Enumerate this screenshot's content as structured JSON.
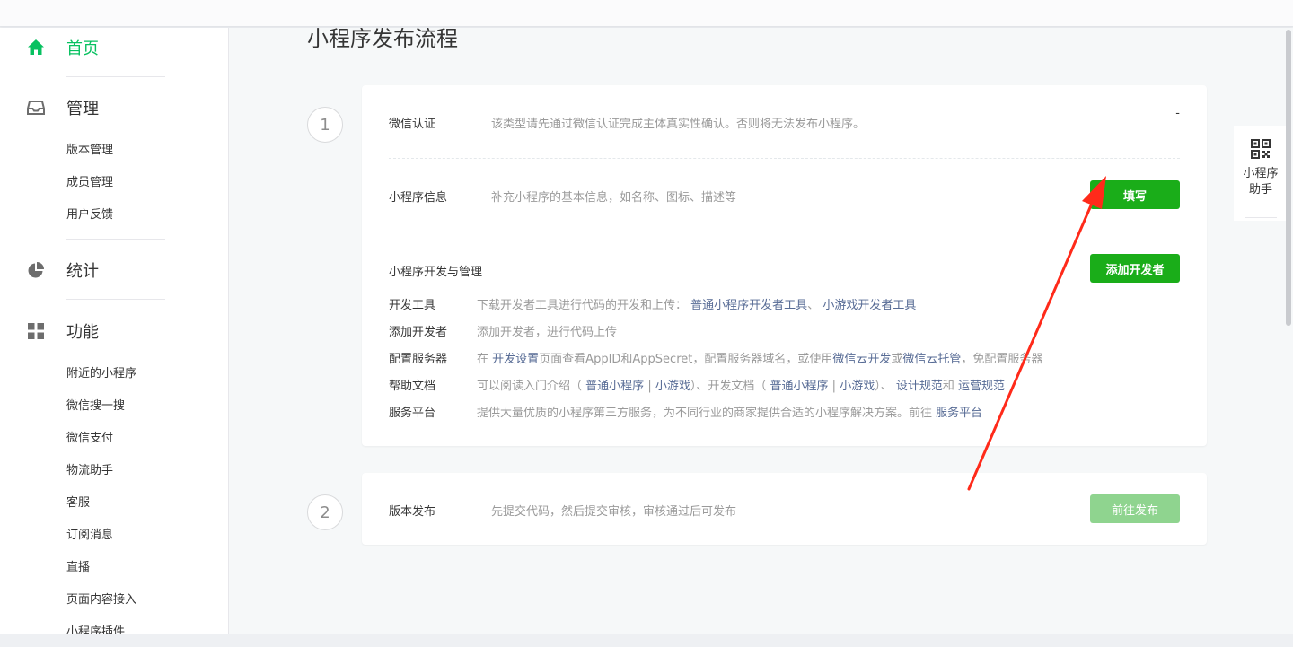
{
  "sidebar": {
    "home": "首页",
    "manage": {
      "label": "管理",
      "items": [
        "版本管理",
        "成员管理",
        "用户反馈"
      ]
    },
    "stats": "统计",
    "features": {
      "label": "功能",
      "items": [
        "附近的小程序",
        "微信搜一搜",
        "微信支付",
        "物流助手",
        "客服",
        "订阅消息",
        "直播",
        "页面内容接入",
        "小程序插件"
      ]
    },
    "active_color": "#07c160"
  },
  "main": {
    "title": "小程序发布流程",
    "step1": {
      "number": "1",
      "wechat_auth": {
        "label": "微信认证",
        "desc": "该类型请先通过微信认证完成主体真实性确认。否则将无法发布小程序。",
        "status": "-"
      },
      "info": {
        "label": "小程序信息",
        "desc": "补充小程序的基本信息，如名称、图标、描述等",
        "button": "填写"
      },
      "dev": {
        "label": "小程序开发与管理",
        "button": "添加开发者",
        "rows": {
          "tools": {
            "label": "开发工具",
            "text": "下载开发者工具进行代码的开发和上传：",
            "link1": "普通小程序开发者工具",
            "sep": "、",
            "link2": "小游戏开发者工具"
          },
          "add": {
            "label": "添加开发者",
            "text": "添加开发者，进行代码上传"
          },
          "server": {
            "label": "配置服务器",
            "text_a": "在",
            "link1": "开发设置",
            "text_b": "页面查看AppID和AppSecret，配置服务器域名，或使用",
            "link2": "微信云开发",
            "text_c": "或",
            "link3": "微信云托管",
            "text_d": "，免配置服务器"
          },
          "help": {
            "label": "帮助文档",
            "text_a": "可以阅读入门介绍（",
            "link1": "普通小程序",
            "bar1": "|",
            "link2": "小游戏",
            "text_b": "）、开发文档（",
            "link3": "普通小程序",
            "bar2": "|",
            "link4": "小游戏",
            "text_c": "）、",
            "link5": "设计规范",
            "text_d": "和",
            "link6": "运营规范"
          },
          "service": {
            "label": "服务平台",
            "text": "提供大量优质的小程序第三方服务，为不同行业的商家提供合适的小程序解决方案。前往",
            "link": "服务平台"
          }
        }
      }
    },
    "step2": {
      "number": "2",
      "label": "版本发布",
      "desc": "先提交代码，然后提交审核，审核通过后可发布",
      "button": "前往发布"
    }
  },
  "helper": {
    "line1": "小程序",
    "line2": "助手",
    "icon": "qr-code-icon"
  },
  "colors": {
    "primary_button": "#1aad19",
    "disabled_button": "#8fd48f",
    "link": "#576b95",
    "annotation_arrow": "#ff2a1a"
  }
}
